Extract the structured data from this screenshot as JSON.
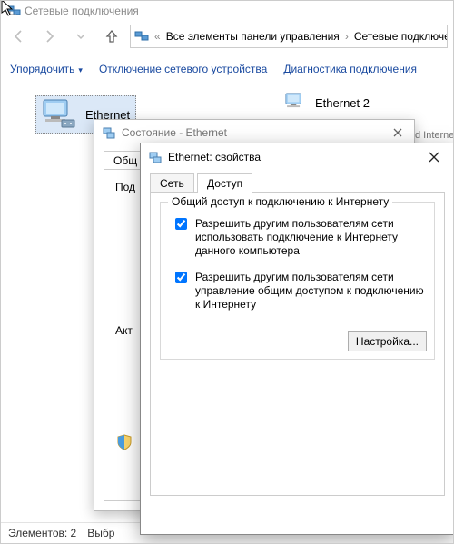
{
  "explorer": {
    "title": "Сетевые подключения",
    "breadcrumb1": "Все элементы панели управления",
    "breadcrumb2": "Сетевые подключения",
    "toolbar": {
      "arrange": "Упорядочить",
      "disable": "Отключение сетевого устройства",
      "diagnose": "Диагностика подключения"
    },
    "items": {
      "ethernet1": "Ethernet",
      "ethernet2": "Ethernet 2",
      "sub2": "d Interne"
    },
    "statusbar": {
      "count": "Элементов: 2",
      "selected": "Выбр"
    }
  },
  "statusWindow": {
    "title": "Состояние - Ethernet",
    "tab_general": "Общ",
    "row_connection": "Под",
    "row_activity": "Акт"
  },
  "propsWindow": {
    "title": "Ethernet: свойства",
    "tab_network": "Сеть",
    "tab_access": "Доступ",
    "group_title": "Общий доступ к подключению к Интернету",
    "check1": "Разрешить другим пользователям сети использовать подключение к Интернету данного компьютера",
    "check2": "Разрешить другим пользователям сети управление общим доступом к подключению к Интернету",
    "settings_btn": "Настройка..."
  }
}
